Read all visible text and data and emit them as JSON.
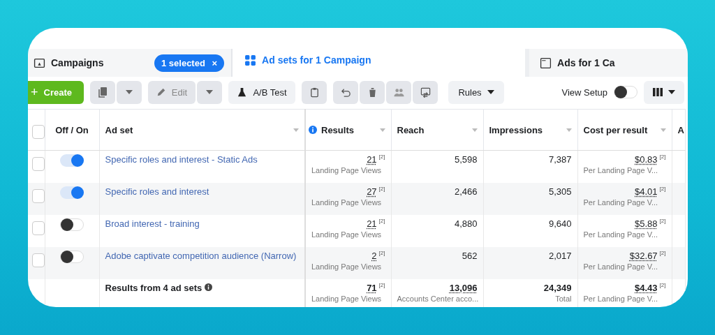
{
  "tabs": [
    {
      "kind": "folder",
      "label": "Campaigns",
      "badge": "1 selected",
      "badge_close": "×",
      "selected": false
    },
    {
      "kind": "grid",
      "label": "Ad sets for 1 Campaign",
      "selected": true
    },
    {
      "kind": "window",
      "label": "Ads for 1 Ca",
      "selected": false
    }
  ],
  "toolbar": {
    "create": "Create",
    "create_plus": "+",
    "edit": "Edit",
    "ab_test": "A/B Test",
    "rules": "Rules",
    "view_setup": {
      "label": "View Setup",
      "on": false
    }
  },
  "table": {
    "header_checkbox": {
      "checked": false
    },
    "columns": [
      {
        "label": "Off / On"
      },
      {
        "label": "Ad set"
      },
      {
        "label": "Results",
        "info": true
      },
      {
        "label": "Reach"
      },
      {
        "label": "Impressions"
      },
      {
        "label": "Cost per result"
      },
      {
        "label": "A"
      }
    ],
    "rows": [
      {
        "checked": false,
        "on": true,
        "name": "Specific roles and interest - Static Ads",
        "results": "21",
        "results_note": "[2]",
        "results_sub": "Landing Page Views",
        "reach": "5,598",
        "impressions": "7,387",
        "cost": "$0.83",
        "cost_note": "[2]",
        "cost_sub": "Per Landing Page V..."
      },
      {
        "checked": false,
        "on": true,
        "name": "Specific roles and interest",
        "results": "27",
        "results_note": "[2]",
        "results_sub": "Landing Page Views",
        "reach": "2,466",
        "impressions": "5,305",
        "cost": "$4.01",
        "cost_note": "[2]",
        "cost_sub": "Per Landing Page V..."
      },
      {
        "checked": false,
        "on": false,
        "name": "Broad interest - training",
        "results": "21",
        "results_note": "[2]",
        "results_sub": "Landing Page Views",
        "reach": "4,880",
        "impressions": "9,640",
        "cost": "$5.88",
        "cost_note": "[2]",
        "cost_sub": "Per Landing Page V..."
      },
      {
        "checked": false,
        "on": false,
        "name": "Adobe captivate competition audience (Narrow)",
        "results": "2",
        "results_note": "[2]",
        "results_sub": "Landing Page Views",
        "reach": "562",
        "impressions": "2,017",
        "cost": "$32.67",
        "cost_note": "[2]",
        "cost_sub": "Per Landing Page V..."
      }
    ],
    "total": {
      "label": "Results from 4 ad sets",
      "results": "71",
      "results_note": "[2]",
      "results_sub": "Landing Page Views",
      "reach": "13,096",
      "reach_sub": "Accounts Center acco...",
      "impressions": "24,349",
      "impressions_sub": "Total",
      "cost": "$4.43",
      "cost_note": "[2]",
      "cost_sub": "Per Landing Page V..."
    }
  }
}
